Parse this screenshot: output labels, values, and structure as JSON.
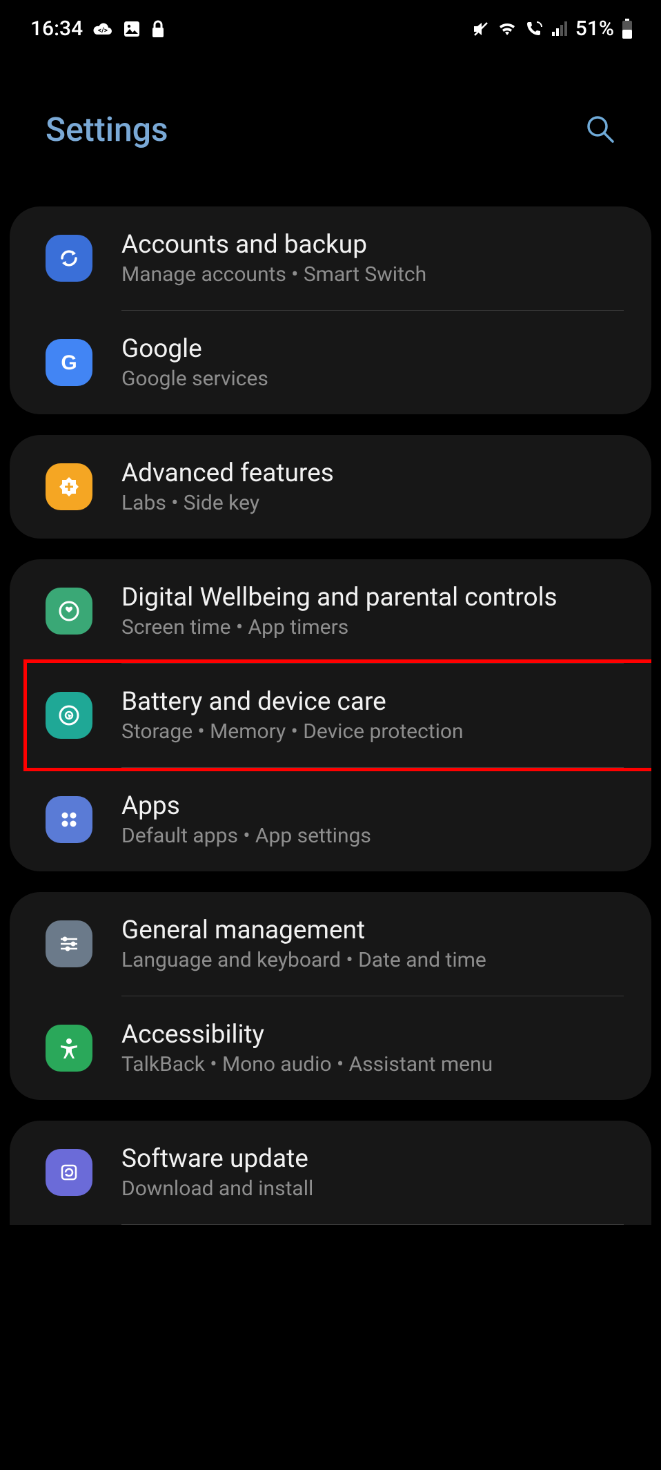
{
  "statusBar": {
    "time": "16:34",
    "battery": "51%"
  },
  "header": {
    "title": "Settings"
  },
  "groups": [
    {
      "rows": [
        {
          "key": "accounts",
          "title": "Accounts and backup",
          "subtitle": "Manage accounts  •  Smart Switch",
          "iconBg": "bg-blue"
        },
        {
          "key": "google",
          "title": "Google",
          "subtitle": "Google services",
          "iconBg": "bg-google"
        }
      ]
    },
    {
      "rows": [
        {
          "key": "advanced",
          "title": "Advanced features",
          "subtitle": "Labs  •  Side key",
          "iconBg": "bg-orange"
        }
      ]
    },
    {
      "rows": [
        {
          "key": "wellbeing",
          "title": "Digital Wellbeing and parental controls",
          "subtitle": "Screen time  •  App timers",
          "iconBg": "bg-green"
        },
        {
          "key": "battery",
          "title": "Battery and device care",
          "subtitle": "Storage  •  Memory  •  Device protection",
          "iconBg": "bg-teal",
          "highlight": true
        },
        {
          "key": "apps",
          "title": "Apps",
          "subtitle": "Default apps  •  App settings",
          "iconBg": "bg-apps"
        }
      ]
    },
    {
      "rows": [
        {
          "key": "general",
          "title": "General management",
          "subtitle": "Language and keyboard  •  Date and time",
          "iconBg": "bg-gray"
        },
        {
          "key": "accessibility",
          "title": "Accessibility",
          "subtitle": "TalkBack  •  Mono audio  •  Assistant menu",
          "iconBg": "bg-access"
        }
      ]
    },
    {
      "rows": [
        {
          "key": "update",
          "title": "Software update",
          "subtitle": "Download and install",
          "iconBg": "bg-update"
        }
      ]
    }
  ]
}
